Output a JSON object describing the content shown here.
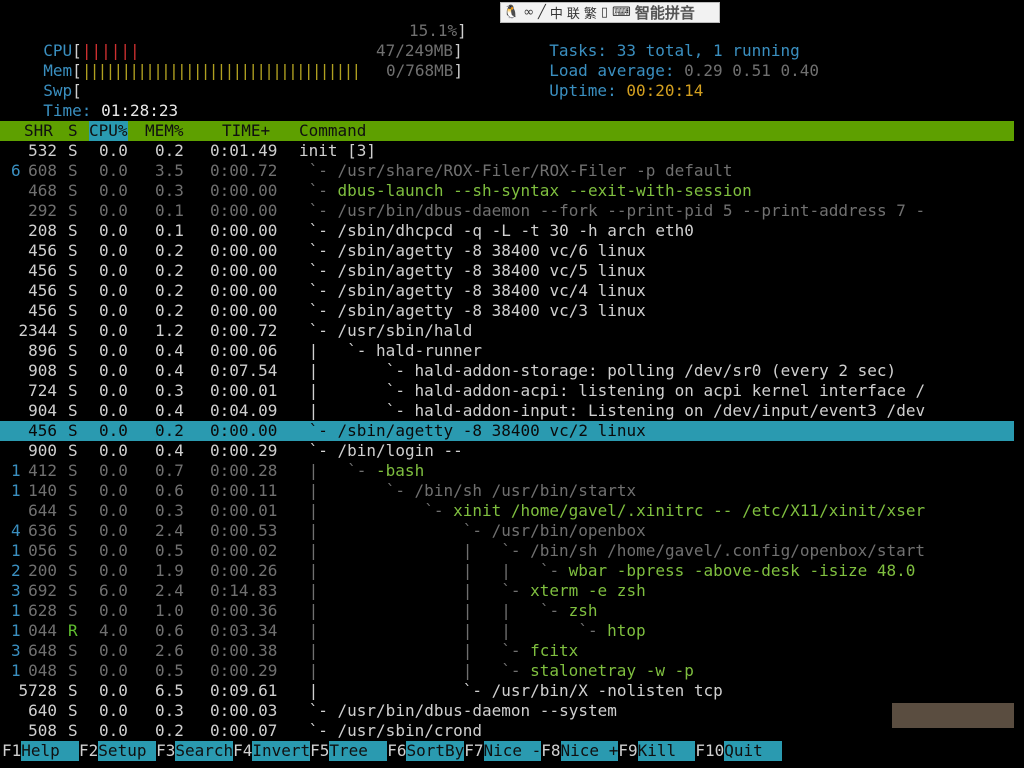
{
  "ime": {
    "icons": [
      "🐧",
      "∞",
      "╱",
      "中",
      "联",
      "繁",
      "▯",
      "⌨"
    ],
    "label": "智能拼音"
  },
  "meters": {
    "cpu": {
      "label": "CPU",
      "bars": "||||||",
      "value": "15.1%",
      "fill": 0.151
    },
    "mem": {
      "label": "Mem",
      "bars": "|||||||||||||||||||||||||||||||||||",
      "value": "47/249MB",
      "fill": 0.19
    },
    "swp": {
      "label": "Swp",
      "bars": "",
      "value": "0/768MB",
      "fill": 0.0
    },
    "time": {
      "label": "Time:",
      "value": "01:28:23"
    }
  },
  "stats": {
    "tasks_label": "Tasks:",
    "tasks_value": "33 total,",
    "running_value": "1 running",
    "load_label": "Load average:",
    "load_value": "0.29 0.51 0.40",
    "uptime_label": "Uptime:",
    "uptime_value": "00:20:14"
  },
  "columns": {
    "shr": "SHR",
    "s": "S",
    "cpu": "CPU%",
    "mem": "MEM%",
    "time": "TIME+",
    "command": "Command"
  },
  "processes": [
    {
      "shr": "532",
      "s": "S",
      "cpu": "0.0",
      "mem": "0.2",
      "time": "0:01.49",
      "tree": "",
      "cmd": "init [3]",
      "style": "normal"
    },
    {
      "shr": "608",
      "s": "S",
      "cpu": "0.0",
      "mem": "3.5",
      "time": "0:00.72",
      "tree": " `- ",
      "cmd": "/usr/share/ROX-Filer/ROX-Filer -p default",
      "style": "dim",
      "lead": "6"
    },
    {
      "shr": "468",
      "s": "S",
      "cpu": "0.0",
      "mem": "0.3",
      "time": "0:00.00",
      "tree": " `- ",
      "cmd": "dbus-launch --sh-syntax --exit-with-session",
      "style": "dim"
    },
    {
      "shr": "292",
      "s": "S",
      "cpu": "0.0",
      "mem": "0.1",
      "time": "0:00.00",
      "tree": " `- ",
      "cmd": "/usr/bin/dbus-daemon --fork --print-pid 5 --print-address 7 -",
      "style": "dim"
    },
    {
      "shr": "208",
      "s": "S",
      "cpu": "0.0",
      "mem": "0.1",
      "time": "0:00.00",
      "tree": " `- ",
      "cmd": "/sbin/dhcpcd -q -L -t 30 -h arch eth0",
      "style": "normal"
    },
    {
      "shr": "456",
      "s": "S",
      "cpu": "0.0",
      "mem": "0.2",
      "time": "0:00.00",
      "tree": " `- ",
      "cmd": "/sbin/agetty -8 38400 vc/6 linux",
      "style": "normal"
    },
    {
      "shr": "456",
      "s": "S",
      "cpu": "0.0",
      "mem": "0.2",
      "time": "0:00.00",
      "tree": " `- ",
      "cmd": "/sbin/agetty -8 38400 vc/5 linux",
      "style": "normal"
    },
    {
      "shr": "456",
      "s": "S",
      "cpu": "0.0",
      "mem": "0.2",
      "time": "0:00.00",
      "tree": " `- ",
      "cmd": "/sbin/agetty -8 38400 vc/4 linux",
      "style": "normal"
    },
    {
      "shr": "456",
      "s": "S",
      "cpu": "0.0",
      "mem": "0.2",
      "time": "0:00.00",
      "tree": " `- ",
      "cmd": "/sbin/agetty -8 38400 vc/3 linux",
      "style": "normal"
    },
    {
      "shr": "2344",
      "s": "S",
      "cpu": "0.0",
      "mem": "1.2",
      "time": "0:00.72",
      "tree": " `- ",
      "cmd": "/usr/sbin/hald",
      "style": "normal"
    },
    {
      "shr": "896",
      "s": "S",
      "cpu": "0.0",
      "mem": "0.4",
      "time": "0:00.06",
      "tree": " |   `- ",
      "cmd": "hald-runner",
      "style": "normal"
    },
    {
      "shr": "908",
      "s": "S",
      "cpu": "0.0",
      "mem": "0.4",
      "time": "0:07.54",
      "tree": " |       `- ",
      "cmd": "hald-addon-storage: polling /dev/sr0 (every 2 sec)",
      "style": "normal"
    },
    {
      "shr": "724",
      "s": "S",
      "cpu": "0.0",
      "mem": "0.3",
      "time": "0:00.01",
      "tree": " |       `- ",
      "cmd": "hald-addon-acpi: listening on acpi kernel interface /",
      "style": "normal"
    },
    {
      "shr": "904",
      "s": "S",
      "cpu": "0.0",
      "mem": "0.4",
      "time": "0:04.09",
      "tree": " |       `- ",
      "cmd": "hald-addon-input: Listening on /dev/input/event3 /dev",
      "style": "normal"
    },
    {
      "shr": "456",
      "s": "S",
      "cpu": "0.0",
      "mem": "0.2",
      "time": "0:00.00",
      "tree": " `- ",
      "cmd": "/sbin/agetty -8 38400 vc/2 linux",
      "style": "selected"
    },
    {
      "shr": "900",
      "s": "S",
      "cpu": "0.0",
      "mem": "0.4",
      "time": "0:00.29",
      "tree": " `- ",
      "cmd": "/bin/login --",
      "style": "normal"
    },
    {
      "shr": "412",
      "s": "S",
      "cpu": "0.0",
      "mem": "0.7",
      "time": "0:00.28",
      "tree": " |   `- ",
      "cmd": "-bash",
      "style": "dim",
      "lead": "1"
    },
    {
      "shr": "140",
      "s": "S",
      "cpu": "0.0",
      "mem": "0.6",
      "time": "0:00.11",
      "tree": " |       `- ",
      "cmd": "/bin/sh /usr/bin/startx",
      "style": "dim",
      "lead": "1"
    },
    {
      "shr": "644",
      "s": "S",
      "cpu": "0.0",
      "mem": "0.3",
      "time": "0:00.01",
      "tree": " |           `- ",
      "cmd": "xinit /home/gavel/.xinitrc -- /etc/X11/xinit/xser",
      "style": "dim"
    },
    {
      "shr": "636",
      "s": "S",
      "cpu": "0.0",
      "mem": "2.4",
      "time": "0:00.53",
      "tree": " |               `- ",
      "cmd": "/usr/bin/openbox",
      "style": "dim",
      "lead": "4"
    },
    {
      "shr": "056",
      "s": "S",
      "cpu": "0.0",
      "mem": "0.5",
      "time": "0:00.02",
      "tree": " |               |   `- ",
      "cmd": "/bin/sh /home/gavel/.config/openbox/start",
      "style": "dim",
      "lead": "1"
    },
    {
      "shr": "200",
      "s": "S",
      "cpu": "0.0",
      "mem": "1.9",
      "time": "0:00.26",
      "tree": " |               |   |   `- ",
      "cmd": "wbar -bpress -above-desk -isize 48.0",
      "style": "dim",
      "lead": "2"
    },
    {
      "shr": "692",
      "s": "S",
      "cpu": "6.0",
      "mem": "2.4",
      "time": "0:14.83",
      "tree": " |               |   `- ",
      "cmd": "xterm -e zsh",
      "style": "dim",
      "lead": "3"
    },
    {
      "shr": "628",
      "s": "S",
      "cpu": "0.0",
      "mem": "1.0",
      "time": "0:00.36",
      "tree": " |               |   |   `- ",
      "cmd": "zsh",
      "style": "dim",
      "lead": "1"
    },
    {
      "shr": "044",
      "s": "R",
      "cpu": "4.0",
      "mem": "0.6",
      "time": "0:03.34",
      "tree": " |               |   |       `- ",
      "cmd": "htop",
      "style": "dim",
      "lead": "1"
    },
    {
      "shr": "648",
      "s": "S",
      "cpu": "0.0",
      "mem": "2.6",
      "time": "0:00.38",
      "tree": " |               |   `- ",
      "cmd": "fcitx",
      "style": "dim",
      "lead": "3"
    },
    {
      "shr": "048",
      "s": "S",
      "cpu": "0.0",
      "mem": "0.5",
      "time": "0:00.29",
      "tree": " |               |   `- ",
      "cmd": "stalonetray -w -p",
      "style": "dim",
      "lead": "1"
    },
    {
      "shr": "5728",
      "s": "S",
      "cpu": "0.0",
      "mem": "6.5",
      "time": "0:09.61",
      "tree": " |               `- ",
      "cmd": "/usr/bin/X -nolisten tcp",
      "style": "normal"
    },
    {
      "shr": "640",
      "s": "S",
      "cpu": "0.0",
      "mem": "0.3",
      "time": "0:00.03",
      "tree": " `- ",
      "cmd": "/usr/bin/dbus-daemon --system",
      "style": "normal"
    },
    {
      "shr": "508",
      "s": "S",
      "cpu": "0.0",
      "mem": "0.2",
      "time": "0:00.07",
      "tree": " `- ",
      "cmd": "/usr/sbin/crond",
      "style": "normal"
    }
  ],
  "function_keys": [
    {
      "key": "F1",
      "label": "Help  "
    },
    {
      "key": "F2",
      "label": "Setup "
    },
    {
      "key": "F3",
      "label": "Search"
    },
    {
      "key": "F4",
      "label": "Invert"
    },
    {
      "key": "F5",
      "label": "Tree  "
    },
    {
      "key": "F6",
      "label": "SortBy"
    },
    {
      "key": "F7",
      "label": "Nice -"
    },
    {
      "key": "F8",
      "label": "Nice +"
    },
    {
      "key": "F9",
      "label": "Kill  "
    },
    {
      "key": "F10",
      "label": "Quit  "
    }
  ]
}
